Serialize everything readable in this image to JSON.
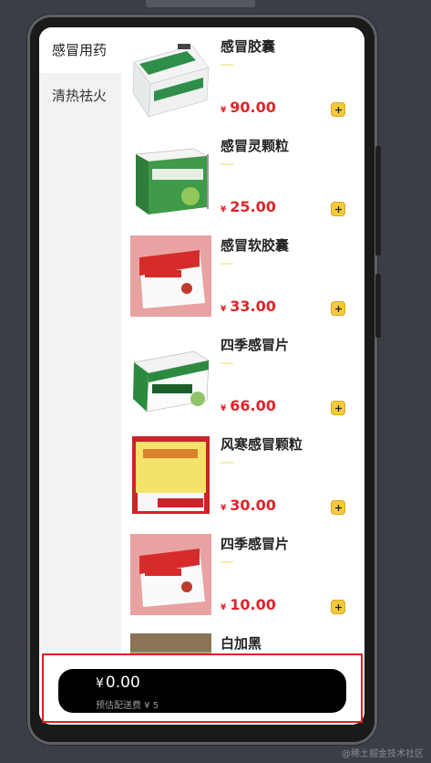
{
  "sidebar": {
    "categories": [
      {
        "label": "感冒用药",
        "active": true
      },
      {
        "label": "清热祛火",
        "active": false
      }
    ]
  },
  "products": [
    {
      "name": "感冒胶囊",
      "currency": "¥",
      "price": "90.00",
      "image": "cold-capsule-box"
    },
    {
      "name": "感冒灵颗粒",
      "currency": "¥",
      "price": "25.00",
      "image": "cold-granule-box"
    },
    {
      "name": "感冒软胶囊",
      "currency": "¥",
      "price": "33.00",
      "image": "soft-capsule-box"
    },
    {
      "name": "四季感冒片",
      "currency": "¥",
      "price": "66.00",
      "image": "four-season-tablet-box"
    },
    {
      "name": "风寒感冒颗粒",
      "currency": "¥",
      "price": "30.00",
      "image": "wind-cold-granule-box"
    },
    {
      "name": "四季感冒片",
      "currency": "¥",
      "price": "10.00",
      "image": "soft-capsule-box"
    },
    {
      "name": "白加黑",
      "currency": "¥",
      "price": "",
      "image": "baijiahei-box"
    }
  ],
  "cart": {
    "currency": "¥",
    "total": "0.00",
    "delivery_fee_text": "预估配送费 ¥ 5"
  },
  "watermark": "@稀土掘金技术社区",
  "colors": {
    "price": "#e0242a",
    "add_button": "#f5c93c",
    "highlight_border": "#e02020",
    "cart_bar": "#000000"
  }
}
